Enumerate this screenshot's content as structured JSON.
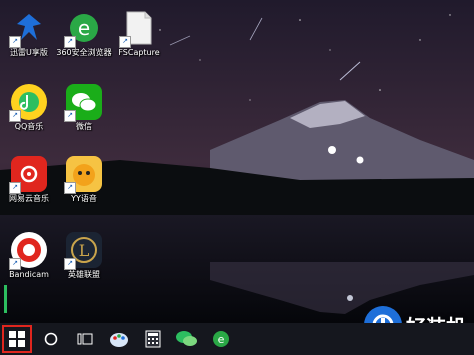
{
  "desktop_icons": [
    {
      "label": "迅雷U享版"
    },
    {
      "label": "360安全浏览器"
    },
    {
      "label": "FSCapture"
    },
    {
      "label": "QQ音乐"
    },
    {
      "label": "微信"
    },
    {
      "label": "网易云音乐"
    },
    {
      "label": "YY语音"
    },
    {
      "label": "Bandicam"
    },
    {
      "label": "英雄联盟"
    }
  ],
  "watermark": {
    "text": "好装机"
  },
  "taskbar": {
    "items": [
      "start-icon",
      "search-circle-icon",
      "task-view-icon",
      "paint-icon",
      "calculator-icon",
      "wechat-icon",
      "360-browser-icon"
    ]
  },
  "colors": {
    "start_highlight": "#e0261e"
  }
}
